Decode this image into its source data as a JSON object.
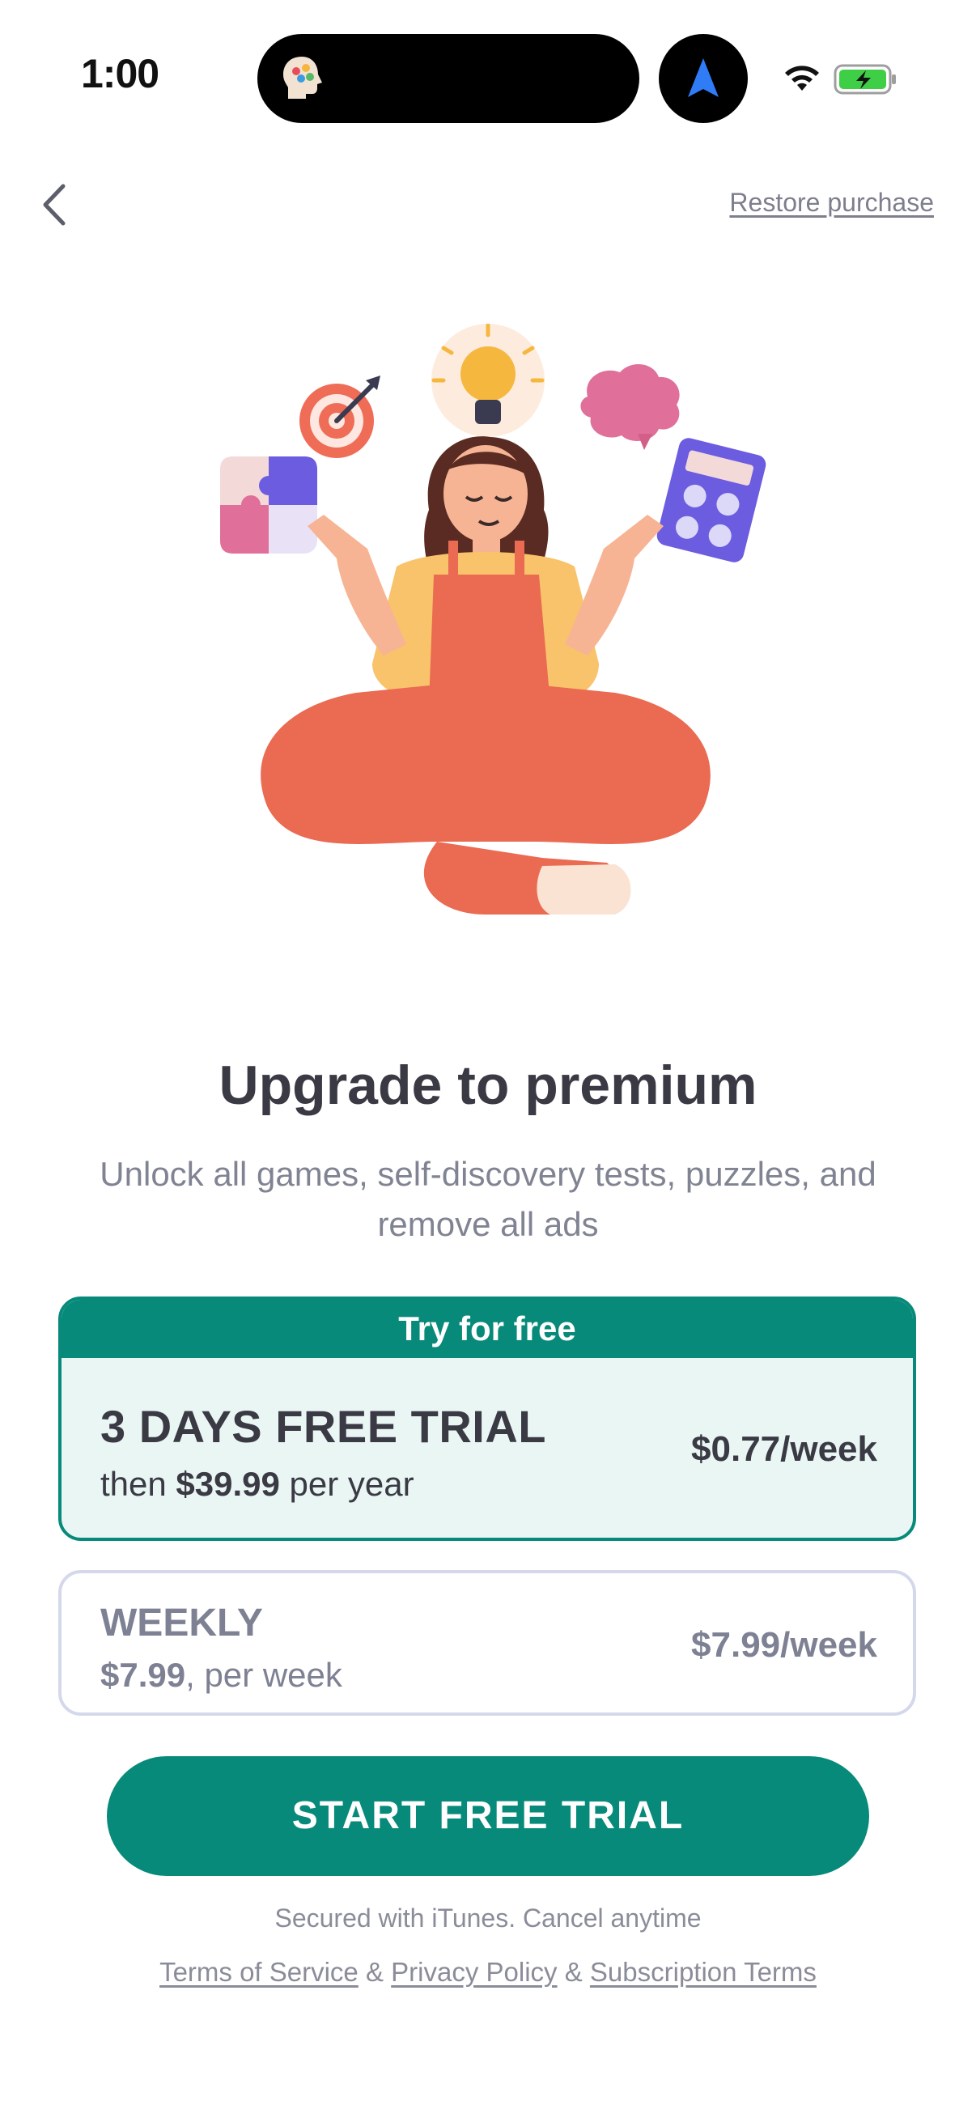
{
  "status_bar": {
    "time": "1:00"
  },
  "header": {
    "back_icon": "chevron-left-icon",
    "restore_label": "Restore purchase"
  },
  "illustration": {
    "description_icon": "meditation-illustration"
  },
  "main": {
    "title": "Upgrade to premium",
    "subtitle": "Unlock all games, self-discovery tests, puzzles, and remove all ads"
  },
  "plans": [
    {
      "badge": "Try for free",
      "name": "3 DAYS FREE TRIAL",
      "desc_prefix": "then ",
      "desc_bold": "$39.99",
      "desc_suffix": " per year",
      "price": "$0.77/week",
      "selected": true
    },
    {
      "name": "WEEKLY",
      "desc_bold": "$7.99",
      "desc_suffix": ", per week",
      "price": "$7.99/week",
      "selected": false
    }
  ],
  "cta": {
    "label": "START FREE TRIAL"
  },
  "footer": {
    "secured": "Secured with iTunes. Cancel anytime",
    "terms": "Terms of Service",
    "sep1": " & ",
    "privacy": "Privacy Policy",
    "sep2": " & ",
    "subscription": "Subscription Terms"
  },
  "colors": {
    "accent": "#078a7a",
    "accent_light": "#eaf6f4",
    "text_dark": "#3a3a44",
    "text_muted": "#808392"
  }
}
